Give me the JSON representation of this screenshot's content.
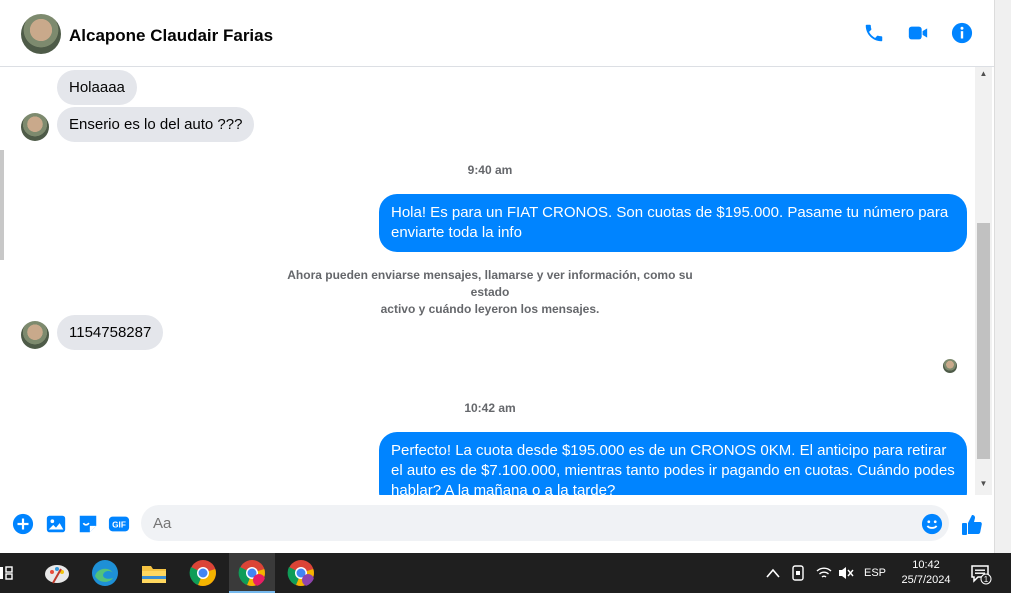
{
  "header": {
    "contact_name": "Alcapone Claudair Farias",
    "icons": [
      "phone-icon",
      "video-camera-icon",
      "info-icon"
    ],
    "accent": "#0084ff"
  },
  "messages": {
    "in_1": "Holaaaa",
    "in_2": "Enserio es lo del auto ???",
    "time_1": "9:40 am",
    "out_1": "Hola! Es para un FIAT CRONOS. Son cuotas de $195.000. Pasame tu número para enviarte toda la info",
    "notice_line1": "Ahora pueden enviarse mensajes, llamarse y ver información, como su estado",
    "notice_line2": "activo y cuándo leyeron los mensajes.",
    "in_3": "1154758287",
    "time_2": "10:42 am",
    "out_2": "Perfecto! La cuota desde $195.000 es de un CRONOS 0KM. El anticipo para retirar el auto es de $7.100.000, mientras tanto podes ir pagando en cuotas. Cuándo podes hablar? A la mañana o a la tarde?"
  },
  "composer": {
    "placeholder": "Aa",
    "icons": [
      "plus-icon",
      "image-icon",
      "sticker-icon",
      "gif-icon",
      "emoji-icon",
      "thumbs-up-icon"
    ],
    "gif_label": "GIF"
  },
  "taskbar": {
    "language": "ESP",
    "time": "10:42",
    "date": "25/7/2024",
    "notification_count": "1"
  }
}
